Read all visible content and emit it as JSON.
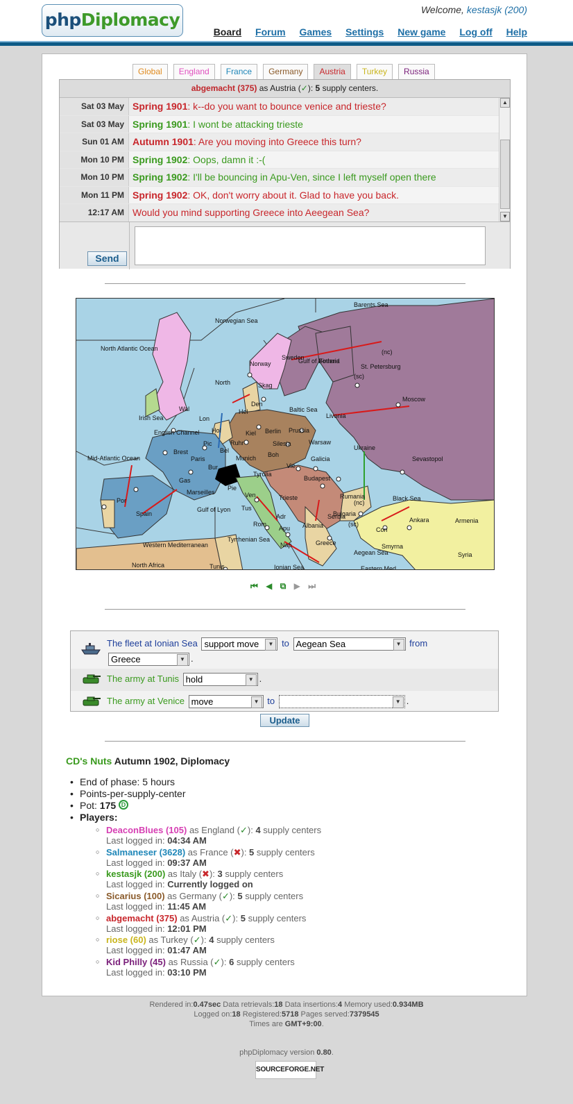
{
  "header": {
    "logo_a": "php",
    "logo_b": "Diplomacy",
    "welcome_text": "Welcome,",
    "username": "kestasjk (200)",
    "nav": [
      "Board",
      "Forum",
      "Games",
      "Settings",
      "New game",
      "Log off",
      "Help"
    ]
  },
  "tabs": [
    {
      "label": "Global",
      "color": "#e08a1e"
    },
    {
      "label": "England",
      "color": "#e04fbf"
    },
    {
      "label": "France",
      "color": "#1e86b8"
    },
    {
      "label": "Germany",
      "color": "#8a5a2a"
    },
    {
      "label": "Austria",
      "color": "#c8262b"
    },
    {
      "label": "Turkey",
      "color": "#c9b51c"
    },
    {
      "label": "Russia",
      "color": "#7a1f7a"
    }
  ],
  "chat": {
    "header_name": "abgemacht (375)",
    "header_as": "as Austria (",
    "header_check": "✓",
    "header_close": "):",
    "header_count": "5",
    "header_suffix": "supply centers.",
    "messages": [
      {
        "time": "Sat 03 May",
        "phase": "Spring 1901",
        "text": ": k--do you want to bounce venice and trieste?",
        "color": "red"
      },
      {
        "time": "Sat 03 May",
        "phase": "Spring 1901",
        "text": ": I wont be attacking trieste",
        "color": "green"
      },
      {
        "time": "Sun 01 AM",
        "phase": "Autumn 1901",
        "text": ": Are you moving into Greece this turn?",
        "color": "red"
      },
      {
        "time": "Mon 10 PM",
        "phase": "Spring 1902",
        "text": ": Oops, damn it :-(",
        "color": "green"
      },
      {
        "time": "Mon 10 PM",
        "phase": "Spring 1902",
        "text": ": I'll be bouncing in Apu-Ven, since I left myself open there",
        "color": "green"
      },
      {
        "time": "Mon 11 PM",
        "phase": "Spring 1902",
        "text": ": OK, don't worry about it. Glad to have you back.",
        "color": "red"
      },
      {
        "time": "12:17 AM",
        "phase": "",
        "text": "Would you mind supporting Greece into Aeegean Sea?",
        "color": "red"
      }
    ],
    "send_label": "Send"
  },
  "map": {
    "labels": [
      {
        "t": "Barents Sea"
      },
      {
        "t": "Norwegian Sea"
      },
      {
        "t": "North Atlantic Ocean"
      },
      {
        "t": "Norway"
      },
      {
        "t": "Sweden"
      },
      {
        "t": "Finland"
      },
      {
        "t": "St. Petersburg"
      },
      {
        "t": "(nc)"
      },
      {
        "t": "Gulf of Bothnia"
      },
      {
        "t": "(sc)"
      },
      {
        "t": "North"
      },
      {
        "t": "Skag"
      },
      {
        "t": "Den"
      },
      {
        "t": "Moscow"
      },
      {
        "t": "Irish Sea"
      },
      {
        "t": "Wal"
      },
      {
        "t": "Lon"
      },
      {
        "t": "Hel"
      },
      {
        "t": "Baltic Sea"
      },
      {
        "t": "Livonia"
      },
      {
        "t": "English Channel"
      },
      {
        "t": "Hol"
      },
      {
        "t": "Kiel"
      },
      {
        "t": "Berlin"
      },
      {
        "t": "Prussia"
      },
      {
        "t": "Pic"
      },
      {
        "t": "Bel"
      },
      {
        "t": "Ruhr"
      },
      {
        "t": "Silesia"
      },
      {
        "t": "Warsaw"
      },
      {
        "t": "Ukraine"
      },
      {
        "t": "Brest"
      },
      {
        "t": "Paris"
      },
      {
        "t": "Munich"
      },
      {
        "t": "Boh"
      },
      {
        "t": "Galicia"
      },
      {
        "t": "Sevastopol"
      },
      {
        "t": "Mid-Atlantic Ocean"
      },
      {
        "t": "Bur"
      },
      {
        "t": "Tyrolia"
      },
      {
        "t": "Vie"
      },
      {
        "t": "Budapest"
      },
      {
        "t": "Gas"
      },
      {
        "t": "Marseilles"
      },
      {
        "t": "Pie"
      },
      {
        "t": "Ven"
      },
      {
        "t": "Trieste"
      },
      {
        "t": "Rumania"
      },
      {
        "t": "Black Sea"
      },
      {
        "t": "Por"
      },
      {
        "t": "Spain"
      },
      {
        "t": "Gulf of Lyon"
      },
      {
        "t": "Tus"
      },
      {
        "t": "Rom"
      },
      {
        "t": "Adr"
      },
      {
        "t": "Serbia"
      },
      {
        "t": "Bulgaria"
      },
      {
        "t": "Ankara"
      },
      {
        "t": "Armenia"
      },
      {
        "t": "(nc)"
      },
      {
        "t": "(sc)"
      },
      {
        "t": "Con"
      },
      {
        "t": "Western Mediterranean"
      },
      {
        "t": "Apu"
      },
      {
        "t": "Tyrrhenian Sea"
      },
      {
        "t": "Nap"
      },
      {
        "t": "Greece"
      },
      {
        "t": "Smyrna"
      },
      {
        "t": "Aegean Sea"
      },
      {
        "t": "Syria"
      },
      {
        "t": "North Africa"
      },
      {
        "t": "Tunis"
      },
      {
        "t": "Ionian Sea"
      },
      {
        "t": "Eastern Med"
      },
      {
        "t": "Albania"
      }
    ]
  },
  "map_nav": [
    "⏮",
    "◀",
    "⧉",
    "▶",
    "⏭"
  ],
  "orders": [
    {
      "unit": "The fleet at Ionian Sea",
      "type": "support move",
      "to_label": "to",
      "target": "Aegean Sea",
      "from_label": "from",
      "from": "Greece"
    },
    {
      "unit": "The army at Tunis",
      "type": "hold"
    },
    {
      "unit": "The army at Venice",
      "type": "move",
      "to_label": "to",
      "target": ""
    }
  ],
  "update_label": "Update",
  "game": {
    "name": "CD's Nuts",
    "phase": "Autumn 1902, Diplomacy",
    "end_phase": "End of phase: 5 hours",
    "scoring": "Points-per-supply-center",
    "pot_label": "Pot:",
    "pot": "175",
    "players_label": "Players:",
    "pot_badge": "D",
    "last_logged_label": "Last logged in:",
    "supply_label": "supply centers",
    "players": [
      {
        "name": "DeaconBlues (105)",
        "country": "England",
        "status": "✓",
        "sc": "4",
        "login": "04:34 AM",
        "color": "#d63fb3"
      },
      {
        "name": "Salmaneser (3628)",
        "country": "France",
        "status": "✖",
        "sc": "5",
        "login": "09:37 AM",
        "color": "#1e86b8"
      },
      {
        "name": "kestasjk (200)",
        "country": "Italy",
        "status": "✖",
        "sc": "3",
        "login": "Currently logged on",
        "color": "#3a9a1e"
      },
      {
        "name": "Sicarius (100)",
        "country": "Germany",
        "status": "✓",
        "sc": "5",
        "login": "11:45 AM",
        "color": "#8a5a2a"
      },
      {
        "name": "abgemacht (375)",
        "country": "Austria",
        "status": "✓",
        "sc": "5",
        "login": "12:01 PM",
        "color": "#c8262b"
      },
      {
        "name": "riose (60)",
        "country": "Turkey",
        "status": "✓",
        "sc": "4",
        "login": "01:47 AM",
        "color": "#c9b51c"
      },
      {
        "name": "Kid Philly (45)",
        "country": "Russia",
        "status": "✓",
        "sc": "6",
        "login": "03:10 PM",
        "color": "#7a1f7a"
      }
    ]
  },
  "footer": {
    "rendered_label": "Rendered in:",
    "rendered": "0.47sec",
    "retr_label": "Data retrievals:",
    "retrievals": "18",
    "ins_label": "Data insertions:",
    "insertions": "4",
    "mem_label": "Memory used:",
    "memory": "0.934MB",
    "logged_label": "Logged on:",
    "logged_on": "18",
    "reg_label": "Registered:",
    "registered": "5718",
    "pages_label": "Pages served:",
    "pages_served": "7379545",
    "times_label": "Times are",
    "timezone": "GMT+9:00",
    "version_label": "phpDiplomacy version",
    "version": "0.80",
    "sf_badge": "SOURCEFORGE.NET"
  }
}
